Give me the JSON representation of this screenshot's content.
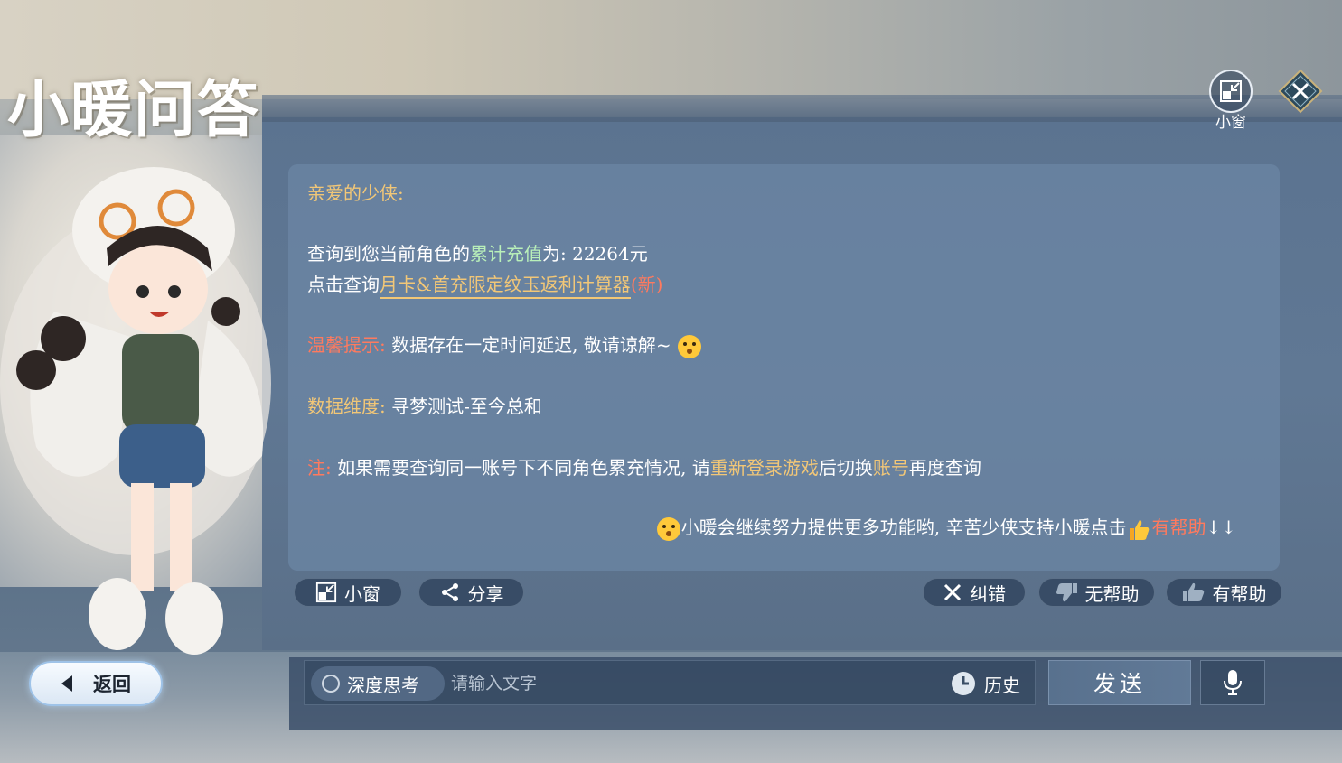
{
  "header": {
    "title": "小暖问答",
    "mini_window_label": "小窗"
  },
  "message": {
    "greeting": "亲爱的少侠:",
    "query_prefix": "查询到您当前角色的",
    "query_highlight": "累计充值",
    "query_suffix": "为: 22264元",
    "click_prefix": "点击查询",
    "calc_link": "月卡&首充限定纹玉返利计算器",
    "calc_new": "(新)",
    "tip_label": "温馨提示:",
    "tip_text": "数据存在一定时间延迟, 敬请谅解~",
    "dimension_label": "数据维度:",
    "dimension_text": "寻梦测试-至今总和",
    "note_label": "注:",
    "note_text_1": "如果需要查询同一账号下不同角色累充情况, 请",
    "note_highlight_1": "重新登录游戏",
    "note_text_2": "后切换",
    "note_highlight_2": "账号",
    "note_text_3": "再度查询",
    "closing_text": "小暖会继续努力提供更多功能哟, 辛苦少侠支持小暖点击",
    "closing_helpful": "有帮助",
    "closing_arrows": "↓↓"
  },
  "actions": {
    "mini_window": "小窗",
    "share": "分享",
    "correct": "纠错",
    "not_helpful": "无帮助",
    "helpful": "有帮助"
  },
  "bottom": {
    "back": "返回",
    "deep_think": "深度思考",
    "input_placeholder": "请输入文字",
    "history": "历史",
    "send": "发送"
  },
  "colors": {
    "gold": "#f2c777",
    "red": "#ff7a5e",
    "green": "#b9f0b9",
    "card": "#6c87a5"
  }
}
